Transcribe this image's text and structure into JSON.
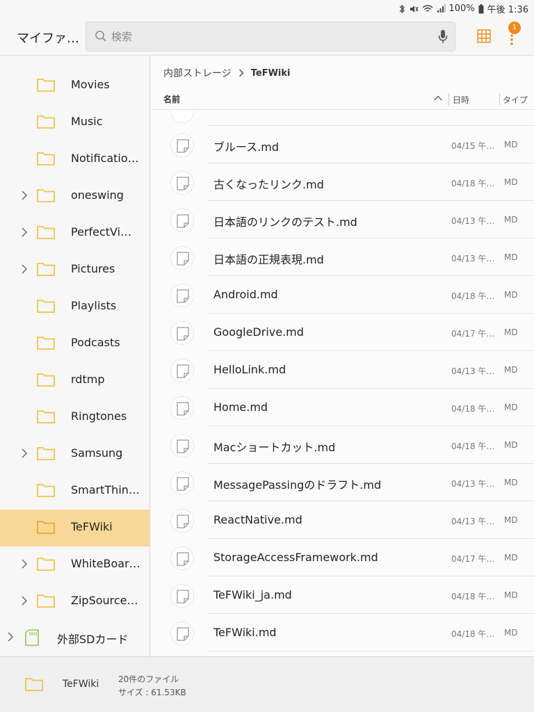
{
  "status_bar": {
    "battery": "100%",
    "time": "午後 1:36"
  },
  "app_bar": {
    "title": "マイファ…",
    "search_placeholder": "検索",
    "badge_count": "1",
    "accent_color": "#f08a1c"
  },
  "sidebar": {
    "items": [
      {
        "label": "Movies",
        "expandable": false
      },
      {
        "label": "Music",
        "expandable": false
      },
      {
        "label": "Notificatio…",
        "expandable": false
      },
      {
        "label": "oneswing",
        "expandable": true
      },
      {
        "label": "PerfectVi…",
        "expandable": true
      },
      {
        "label": "Pictures",
        "expandable": true
      },
      {
        "label": "Playlists",
        "expandable": false
      },
      {
        "label": "Podcasts",
        "expandable": false
      },
      {
        "label": "rdtmp",
        "expandable": false
      },
      {
        "label": "Ringtones",
        "expandable": false
      },
      {
        "label": "Samsung",
        "expandable": true
      },
      {
        "label": "SmartThin…",
        "expandable": false
      },
      {
        "label": "TeFWiki",
        "expandable": false,
        "selected": true
      },
      {
        "label": "WhiteBoar…",
        "expandable": true
      },
      {
        "label": "ZipSource…",
        "expandable": true
      }
    ],
    "sd_card": {
      "label": "外部SDカード"
    }
  },
  "main": {
    "breadcrumb": {
      "root": "内部ストレージ",
      "current": "TeFWiki"
    },
    "columns": {
      "name": "名前",
      "date": "日時",
      "type": "タイプ"
    },
    "files": [
      {
        "name": "ブルース.md",
        "date": "04/15 午…",
        "type": "MD"
      },
      {
        "name": "古くなったリンク.md",
        "date": "04/18 午…",
        "type": "MD"
      },
      {
        "name": "日本語のリンクのテスト.md",
        "date": "04/13 午…",
        "type": "MD"
      },
      {
        "name": "日本語の正規表現.md",
        "date": "04/13 午…",
        "type": "MD"
      },
      {
        "name": "Android.md",
        "date": "04/18 午…",
        "type": "MD"
      },
      {
        "name": "GoogleDrive.md",
        "date": "04/17 午…",
        "type": "MD"
      },
      {
        "name": "HelloLink.md",
        "date": "04/13 午…",
        "type": "MD"
      },
      {
        "name": "Home.md",
        "date": "04/18 午…",
        "type": "MD"
      },
      {
        "name": "Macショートカット.md",
        "date": "04/18 午…",
        "type": "MD"
      },
      {
        "name": "MessagePassingのドラフト.md",
        "date": "04/13 午…",
        "type": "MD"
      },
      {
        "name": "ReactNative.md",
        "date": "04/13 午…",
        "type": "MD"
      },
      {
        "name": "StorageAccessFramework.md",
        "date": "04/17 午…",
        "type": "MD"
      },
      {
        "name": "TeFWiki_ja.md",
        "date": "04/18 午…",
        "type": "MD"
      },
      {
        "name": "TeFWiki.md",
        "date": "04/18 午…",
        "type": "MD"
      }
    ]
  },
  "bottom_bar": {
    "folder_name": "TeFWiki",
    "file_count": "20件のファイル",
    "size": "サイズ : 61.53KB"
  },
  "colors": {
    "folder": "#f1c150",
    "selected_bg": "#f8d896",
    "sd_card": "#9ccc65"
  }
}
